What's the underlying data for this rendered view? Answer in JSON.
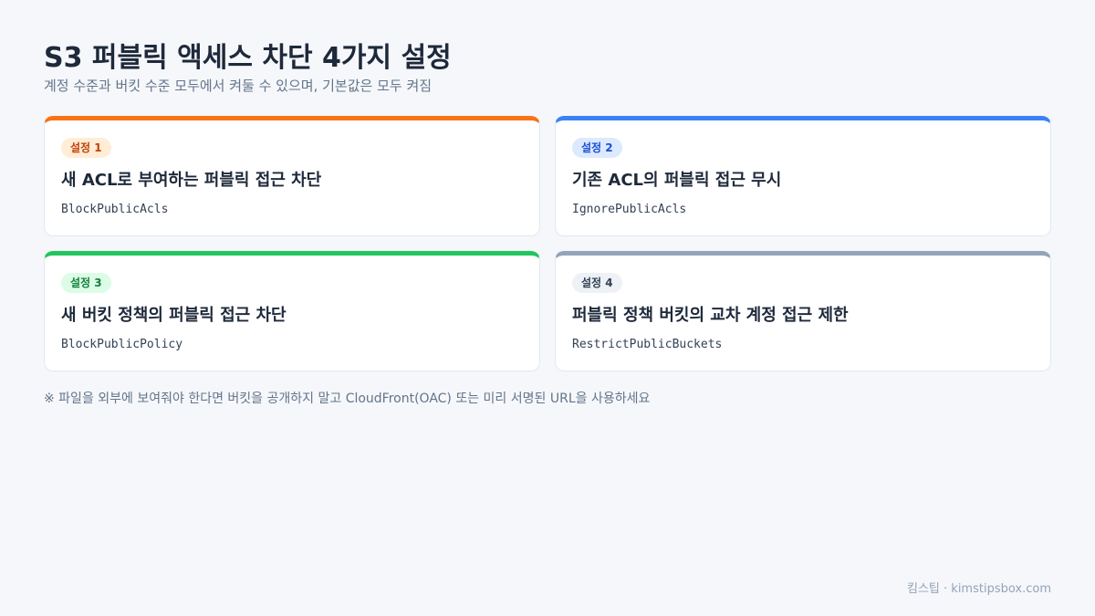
{
  "header": {
    "title": "S3 퍼블릭 액세스 차단 4가지 설정",
    "subtitle": "계정 수준과 버킷 수준 모두에서 켜둘 수 있으며, 기본값은 모두 켜짐"
  },
  "settings": [
    {
      "badge": "설정 1",
      "title": "새 ACL로 부여하는 퍼블릭 접근 차단",
      "code": "BlockPublicAcls",
      "accent_color": "#f97316"
    },
    {
      "badge": "설정 2",
      "title": "기존 ACL의 퍼블릭 접근 무시",
      "code": "IgnorePublicAcls",
      "accent_color": "#3b82f6"
    },
    {
      "badge": "설정 3",
      "title": "새 버킷 정책의 퍼블릭 접근 차단",
      "code": "BlockPublicPolicy",
      "accent_color": "#22c55e"
    },
    {
      "badge": "설정 4",
      "title": "퍼블릭 정책 버킷의 교차 계정 접근 제한",
      "code": "RestrictPublicBuckets",
      "accent_color": "#94a3b8"
    }
  ],
  "footnote": "※ 파일을 외부에 보여줘야 한다면 버킷을 공개하지 말고 CloudFront(OAC) 또는 미리 서명된 URL을 사용하세요",
  "credit": "킴스팁 · kimstipsbox.com"
}
